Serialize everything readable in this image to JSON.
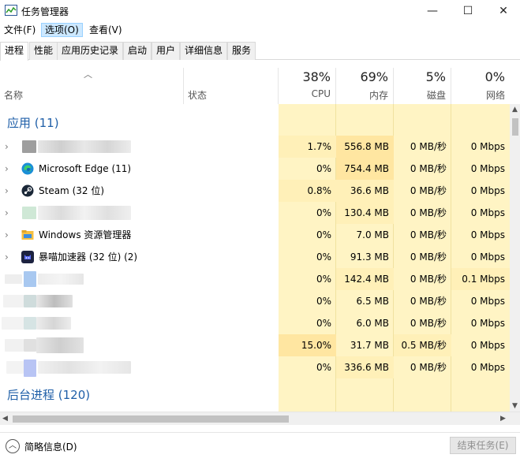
{
  "window": {
    "title": "任务管理器",
    "minimize_glyph": "—",
    "maximize_glyph": "☐",
    "close_glyph": "✕"
  },
  "menu": [
    "文件(F)",
    "选项(O)",
    "查看(V)"
  ],
  "tabs": [
    "进程",
    "性能",
    "应用历史记录",
    "启动",
    "用户",
    "详细信息",
    "服务"
  ],
  "header": {
    "name_label": "名称",
    "status_label": "状态",
    "cpu": {
      "percent": "38%",
      "label": "CPU"
    },
    "memory": {
      "percent": "69%",
      "label": "内存"
    },
    "disk": {
      "percent": "5%",
      "label": "磁盘"
    },
    "network": {
      "percent": "0%",
      "label": "网络"
    }
  },
  "groups": {
    "apps": "应用 (11)",
    "background": "后台进程 (120)"
  },
  "processes": [
    {
      "name": "",
      "cpu": "1.7%",
      "memory": "556.8 MB",
      "disk": "0 MB/秒",
      "network": "0 Mbps",
      "icon": "blurred-icon"
    },
    {
      "name": "Microsoft Edge (11)",
      "cpu": "0%",
      "memory": "754.4 MB",
      "disk": "0 MB/秒",
      "network": "0 Mbps",
      "icon": "edge-icon"
    },
    {
      "name": "Steam (32 位)",
      "cpu": "0.8%",
      "memory": "36.6 MB",
      "disk": "0 MB/秒",
      "network": "0 Mbps",
      "icon": "steam-icon"
    },
    {
      "name": "",
      "cpu": "0%",
      "memory": "130.4 MB",
      "disk": "0 MB/秒",
      "network": "0 Mbps",
      "icon": "blurred-icon"
    },
    {
      "name": "Windows 资源管理器",
      "cpu": "0%",
      "memory": "7.0 MB",
      "disk": "0 MB/秒",
      "network": "0 Mbps",
      "icon": "folder-icon"
    },
    {
      "name": "暴喵加速器 (32 位) (2)",
      "cpu": "0%",
      "memory": "91.3 MB",
      "disk": "0 MB/秒",
      "network": "0 Mbps",
      "icon": "accelerator-icon"
    },
    {
      "name": "",
      "cpu": "0%",
      "memory": "142.4 MB",
      "disk": "0 MB/秒",
      "network": "0.1 Mbps",
      "icon": "blurred-icon"
    },
    {
      "name": "",
      "cpu": "0%",
      "memory": "6.5 MB",
      "disk": "0 MB/秒",
      "network": "0 Mbps",
      "icon": "blurred-icon"
    },
    {
      "name": "",
      "cpu": "0%",
      "memory": "6.0 MB",
      "disk": "0 MB/秒",
      "network": "0 Mbps",
      "icon": "blurred-icon"
    },
    {
      "name": "",
      "cpu": "15.0%",
      "memory": "31.7 MB",
      "disk": "0.5 MB/秒",
      "network": "0 Mbps",
      "icon": "blurred-icon"
    },
    {
      "name": "",
      "cpu": "0%",
      "memory": "336.6 MB",
      "disk": "0 MB/秒",
      "network": "0 Mbps",
      "icon": "blurred-icon"
    }
  ],
  "footer": {
    "fewer_details": "简略信息(D)",
    "end_task": "结束任务(E)"
  },
  "colors": {
    "heat_light": "#fff4c4",
    "heat_medium": "#ffe6a1",
    "group_header": "#1f5fa8"
  }
}
